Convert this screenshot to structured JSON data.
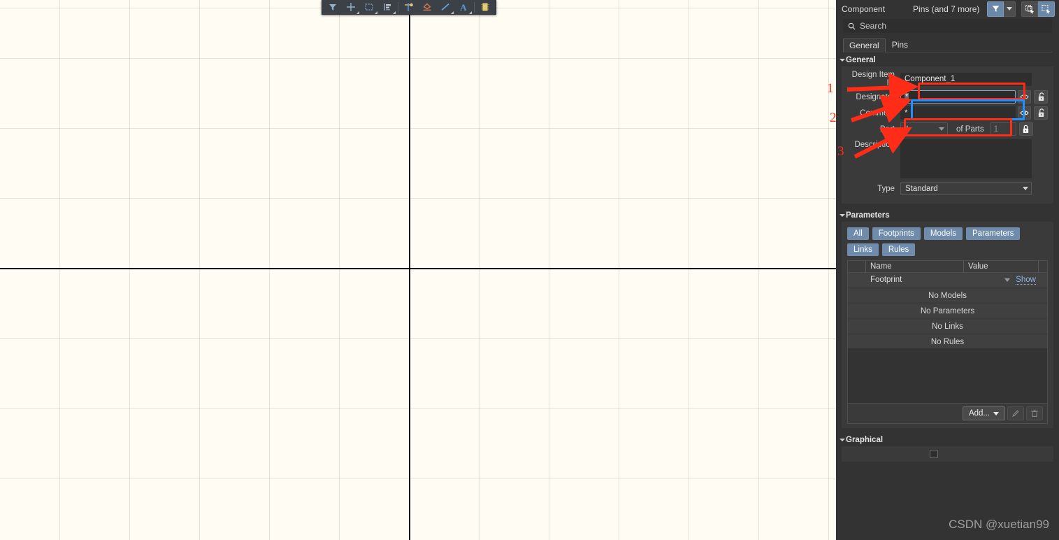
{
  "canvas": {
    "toolbar": {
      "tools": [
        {
          "name": "filter-tool",
          "icon": "funnel-icon",
          "has_caret": false
        },
        {
          "name": "crosshair-tool",
          "icon": "crosshair-icon",
          "has_caret": true
        },
        {
          "name": "select-area-tool",
          "icon": "dashed-rect-icon",
          "has_caret": true
        },
        {
          "name": "align-tool",
          "icon": "align-left-icon",
          "has_caret": true
        },
        {
          "name": "place-pin-tool",
          "icon": "pin-icon",
          "has_caret": false
        },
        {
          "name": "place-symbol-tool",
          "icon": "symbol-icon",
          "has_caret": false
        },
        {
          "name": "place-line-tool",
          "icon": "line-icon",
          "has_caret": true
        },
        {
          "name": "place-text-tool",
          "icon": "text-a-icon",
          "has_caret": true
        },
        {
          "name": "place-component-tool",
          "icon": "ic-chip-icon",
          "has_caret": false
        }
      ]
    }
  },
  "panel": {
    "header": {
      "title": "Component",
      "subtitle": "Pins (and 7 more)",
      "filter_button": "funnel-icon",
      "filter_dropdown": "chevron-down-icon",
      "mode_buttons": [
        "select-inside-icon",
        "select-touching-icon"
      ]
    },
    "search": {
      "placeholder": "Search",
      "icon": "search-icon",
      "value": ""
    },
    "tabs": [
      {
        "label": "General",
        "active": true
      },
      {
        "label": "Pins",
        "active": false
      }
    ],
    "general": {
      "section_label": "General",
      "fields": {
        "design_item_id": {
          "label": "Design Item ID",
          "value": "Component_1"
        },
        "designator": {
          "label": "Designator",
          "value": "*",
          "focused": true,
          "eye_icon": "eye-icon",
          "lock_icon": "unlocked-icon"
        },
        "comment": {
          "label": "Comment",
          "value": "*",
          "eye_icon": "eye-icon",
          "lock_icon": "unlocked-icon"
        },
        "part": {
          "label": "Part",
          "value": "1",
          "disabled": true
        },
        "of_parts": {
          "label": "of Parts",
          "value": "1",
          "disabled": true,
          "lock_icon": "locked-icon"
        },
        "description": {
          "label": "Description",
          "value": ""
        },
        "type": {
          "label": "Type",
          "value": "Standard"
        }
      }
    },
    "parameters": {
      "section_label": "Parameters",
      "filters": [
        "All",
        "Footprints",
        "Models",
        "Parameters",
        "Links",
        "Rules"
      ],
      "columns": [
        "Name",
        "Value"
      ],
      "rows": [
        {
          "name": "Footprint",
          "value": "",
          "action": "Show",
          "has_dropdown": true
        }
      ],
      "empty_rows": [
        "No Models",
        "No Parameters",
        "No Links",
        "No Rules"
      ],
      "footer": {
        "add_label": "Add...",
        "edit_icon": "pencil-icon",
        "delete_icon": "trash-icon"
      }
    },
    "graphical": {
      "section_label": "Graphical",
      "mirrored_checkbox": false
    }
  },
  "annotations": {
    "numbers": [
      "1",
      "2",
      "3"
    ],
    "highlight_colors": {
      "red": "#ff2d17",
      "blue": "#1e90ff"
    }
  },
  "watermark": "CSDN @xuetian99"
}
